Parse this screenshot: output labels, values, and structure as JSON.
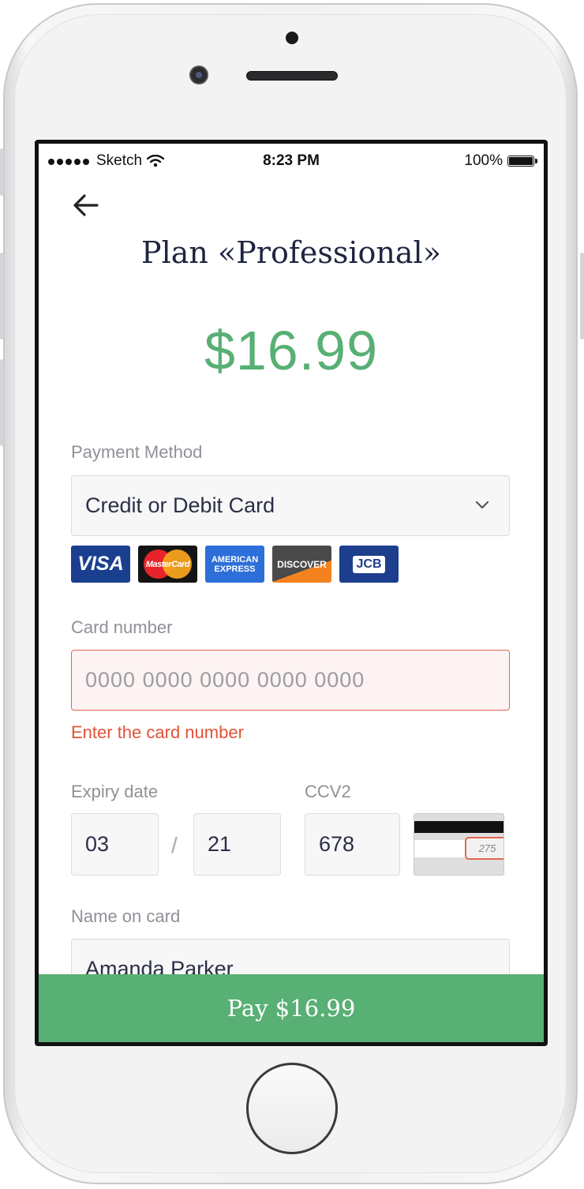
{
  "statusbar": {
    "carrier": "Sketch",
    "time": "8:23 PM",
    "battery": "100%"
  },
  "header": {
    "title": "Plan «Professional»",
    "price": "$16.99"
  },
  "payment_method": {
    "label": "Payment Method",
    "value": "Credit or Debit Card",
    "card_logos": [
      "VISA",
      "MasterCard",
      "AMERICAN EXPRESS",
      "DISCOVER",
      "JCB"
    ]
  },
  "card_number": {
    "label": "Card number",
    "placeholder": "0000 0000 0000 0000 0000",
    "error": "Enter the card number"
  },
  "expiry": {
    "label": "Expiry date",
    "month": "03",
    "separator": "/",
    "year": "21"
  },
  "ccv": {
    "label": "CCV2",
    "value": "678",
    "hint_digits": "275"
  },
  "name": {
    "label": "Name on card",
    "value": "Amanda Parker"
  },
  "pay_button": {
    "label": "Pay $16.99"
  },
  "colors": {
    "accent_green": "#58b074",
    "error_red": "#e15337",
    "title_navy": "#1f2540"
  }
}
